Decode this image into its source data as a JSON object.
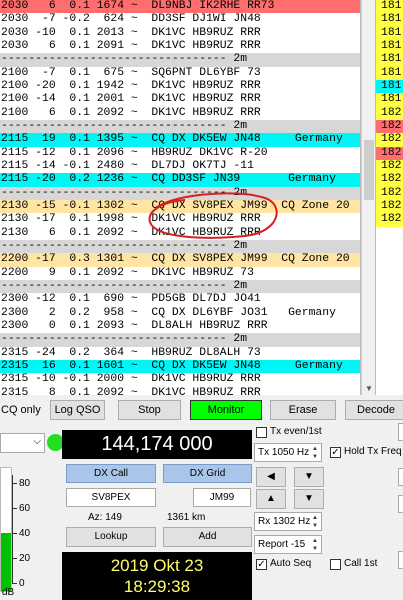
{
  "decode_rows": [
    {
      "text": "2030   6  0.1 1674 ~  DL9NBJ IK2RHE RR73",
      "style": "red"
    },
    {
      "text": "2030  -7 -0.2  624 ~  DD3SF DJ1WI JN48",
      "style": ""
    },
    {
      "text": "2030 -10  0.1 2013 ~  DK1VC HB9RUZ RRR",
      "style": ""
    },
    {
      "text": "2030   6  0.1 2091 ~  DK1VC HB9RUZ RRR",
      "style": ""
    },
    {
      "text": "--------------------------------- 2m",
      "style": "sep"
    },
    {
      "text": "2100  -7  0.1  675 ~  SQ6PNT DL6YBF 73",
      "style": ""
    },
    {
      "text": "2100 -20  0.1 1942 ~  DK1VC HB9RUZ RRR",
      "style": ""
    },
    {
      "text": "2100 -14  0.1 2001 ~  DK1VC HB9RUZ RRR",
      "style": ""
    },
    {
      "text": "2100   6  0.1 2092 ~  DK1VC HB9RUZ RRR",
      "style": ""
    },
    {
      "text": "--------------------------------- 2m",
      "style": "sep"
    },
    {
      "text": "2115  19  0.1 1395 ~  CQ DX DK5EW JN48     Germany",
      "style": "cyan"
    },
    {
      "text": "2115 -12  0.1 2096 ~  HB9RUZ DK1VC R-20",
      "style": ""
    },
    {
      "text": "2115 -14 -0.1 2480 ~  DL7DJ OK7TJ -11",
      "style": ""
    },
    {
      "text": "2115 -20  0.2 1236 ~  CQ DD3SF JN39       Germany",
      "style": "cyan"
    },
    {
      "text": "--------------------------------- 2m",
      "style": "sep"
    },
    {
      "text": "2130 -15 -0.1 1302 ~  CQ DX SV8PEX JM99  CQ Zone 20",
      "style": "yellow"
    },
    {
      "text": "2130 -17  0.1 1998 ~  DK1VC HB9RUZ RRR",
      "style": ""
    },
    {
      "text": "2130   6  0.1 2092 ~  DK1VC HB9RUZ RRR",
      "style": ""
    },
    {
      "text": "--------------------------------- 2m",
      "style": "sep"
    },
    {
      "text": "2200 -17  0.3 1301 ~  CQ DX SV8PEX JM99  CQ Zone 20",
      "style": "yellow"
    },
    {
      "text": "2200   9  0.1 2092 ~  DK1VC HB9RUZ 73",
      "style": ""
    },
    {
      "text": "--------------------------------- 2m",
      "style": "sep"
    },
    {
      "text": "2300 -12  0.1  690 ~  PD5GB DL7DJ JO41",
      "style": ""
    },
    {
      "text": "2300   2  0.2  958 ~  CQ DX DL6YBF JO31   Germany",
      "style": ""
    },
    {
      "text": "2300   0  0.1 2093 ~  DL8ALH HB9RUZ RRR",
      "style": ""
    },
    {
      "text": "--------------------------------- 2m",
      "style": "sep"
    },
    {
      "text": "2315 -24  0.2  364 ~  HB9RUZ DL8ALH 73",
      "style": ""
    },
    {
      "text": "2315  16  0.1 1601 ~  CQ DX DK5EW JN48     Germany",
      "style": "cyan"
    },
    {
      "text": "2315 -10 -0.1 2000 ~  DK1VC HB9RUZ RRR",
      "style": ""
    },
    {
      "text": "2315   8  0.1 2092 ~  DK1VC HB9RUZ RRR",
      "style": ""
    }
  ],
  "right_rows": [
    {
      "text": "181",
      "style": "yellow"
    },
    {
      "text": "181",
      "style": "yellow"
    },
    {
      "text": "181",
      "style": "yellow"
    },
    {
      "text": "181",
      "style": "yellow"
    },
    {
      "text": "181",
      "style": "yellow"
    },
    {
      "text": "181",
      "style": "yellow"
    },
    {
      "text": "181",
      "style": "cyan"
    },
    {
      "text": "181",
      "style": "yellow"
    },
    {
      "text": "182",
      "style": "yellow"
    },
    {
      "text": "182",
      "style": "red"
    },
    {
      "text": "182",
      "style": "yellow"
    },
    {
      "text": "182",
      "style": "red"
    },
    {
      "text": "182",
      "style": "yellow"
    },
    {
      "text": "182",
      "style": "yellow"
    },
    {
      "text": "182",
      "style": "yellow"
    },
    {
      "text": "182",
      "style": "yellow"
    },
    {
      "text": "182",
      "style": "yellow"
    },
    {
      "text": "",
      "style": "white"
    }
  ],
  "buttons": {
    "cq_only": "CQ only",
    "log_qso": "Log QSO",
    "stop": "Stop",
    "monitor": "Monitor",
    "erase": "Erase",
    "decode": "Decode"
  },
  "frequency": "144,174 000",
  "tx_even": "Tx even/1st",
  "tx_hz": "Tx  1050  Hz",
  "hold_tx_freq": "Hold Tx Freq",
  "rx_hz": "Rx  1302  Hz",
  "report": "Report -15",
  "auto_seq": "Auto Seq",
  "call_1st": "Call 1st",
  "dx_call_label": "DX Call",
  "dx_grid_label": "DX Grid",
  "dx_call": "SV8PEX",
  "dx_grid": "JM99",
  "az": "Az: 149",
  "dist": "1361 km",
  "lookup": "Lookup",
  "add": "Add",
  "date": "2019 Okt 23",
  "time": "18:29:38",
  "meter_ticks": [
    "80",
    "60",
    "40",
    "20",
    "0"
  ],
  "meter_unit": "dB",
  "status_dot_color": "#22dd22"
}
